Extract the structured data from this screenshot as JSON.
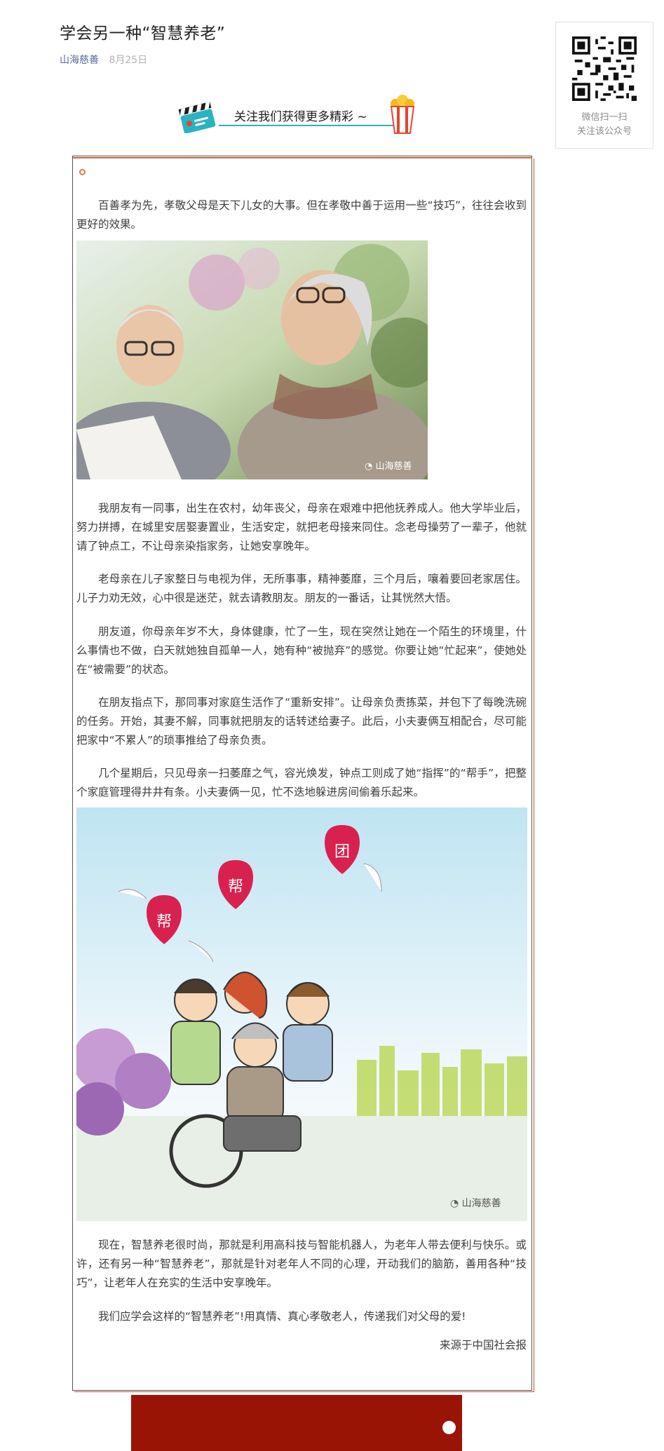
{
  "article": {
    "title": "学会另一种“智慧养老”",
    "author": "山海慈善",
    "date": "8月25日"
  },
  "qr": {
    "caption_line1": "微信扫一扫",
    "caption_line2": "关注该公众号",
    "icon": "qr-code-icon"
  },
  "follow_banner": {
    "text": "关注我们获得更多精彩 ~",
    "left_icon": "clapperboard-icon",
    "right_icon": "popcorn-icon",
    "colors": {
      "teal": "#2ab3c0",
      "red": "#e4452f",
      "yellow": "#f4b91b"
    }
  },
  "paragraphs": [
    "百善孝为先，孝敬父母是天下儿女的大事。但在孝敬中善于运用一些“技巧”，往往会收到更好的效果。",
    "我朋友有一同事，出生在农村，幼年丧父，母亲在艰难中把他抚养成人。他大学毕业后，努力拼搏，在城里安居娶妻置业，生活安定，就把老母接来同住。念老母操劳了一辈子，他就请了钟点工，不让母亲染指家务，让她安享晚年。",
    "老母亲在儿子家整日与电视为伴，无所事事，精神萎靡，三个月后，嚷着要回老家居住。儿子力劝无效，心中很是迷茫，就去请教朋友。朋友的一番话，让其恍然大悟。",
    "朋友道，你母亲年岁不大，身体健康，忙了一生，现在突然让她在一个陌生的环境里，什么事情也不做，白天就她独自孤单一人，她有种“被抛弃”的感觉。你要让她“忙起来”，使她处在“被需要”的状态。",
    "在朋友指点下，那同事对家庭生活作了“重新安排”。让母亲负责拣菜，并包下了每晚洗碗的任务。开始，其妻不解，同事就把朋友的话转述给妻子。此后，小夫妻俩互相配合，尽可能把家中“不累人”的琐事推给了母亲负责。",
    "几个星期后，只见母亲一扫萎靡之气，容光焕发，钟点工则成了她“指挥”的“帮手”，把整个家庭管理得井井有条。小夫妻俩一见，忙不迭地躲进房间偷着乐起来。",
    "现在，智慧养老很时尚，那就是利用高科技与智能机器人，为老年人带去便利与快乐。或许，还有另一种“智慧养老”，那就是针对老年人不同的心理，开动我们的脑筋，善用各种“技巧”，让老年人在充实的生活中安享晚年。",
    "我们应学会这样的“智慧养老”!用真情、真心孝敬老人，传递我们对父母的爱!"
  ],
  "source": "来源于中国社会报",
  "images": {
    "photo1_watermark": "山海慈善",
    "photo2_watermark": "山海慈善",
    "heart_labels": [
      "帮",
      "帮",
      "团"
    ]
  },
  "theme": {
    "author_color": "#576b95",
    "frame_accent": "#c8693f",
    "bottom_bar": "#9a1406",
    "heart_color": "#d9214f"
  }
}
